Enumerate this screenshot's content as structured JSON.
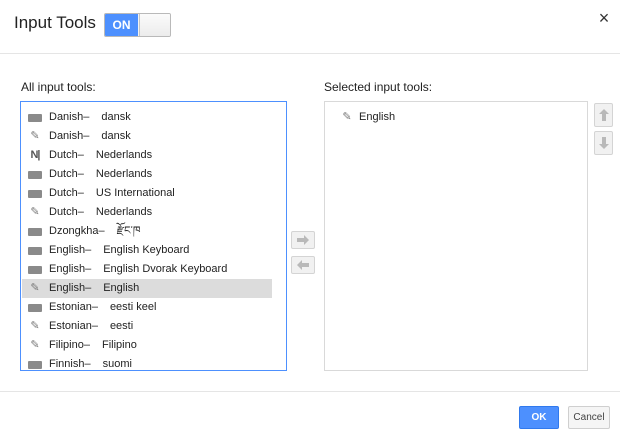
{
  "header": {
    "title": "Input Tools",
    "toggle_label": "ON",
    "close_glyph": "×"
  },
  "all_tools": {
    "label": "All input tools:",
    "items": [
      {
        "icon": "keyboard-icon",
        "lang": "Danish",
        "name": "dansk",
        "selected": false
      },
      {
        "icon": "pencil-icon",
        "lang": "Danish",
        "name": "dansk",
        "selected": false
      },
      {
        "icon": "nl-icon",
        "lang": "Dutch",
        "name": "Nederlands",
        "selected": false
      },
      {
        "icon": "keyboard-icon",
        "lang": "Dutch",
        "name": "Nederlands",
        "selected": false
      },
      {
        "icon": "keyboard-icon",
        "lang": "Dutch",
        "name": "US International",
        "selected": false
      },
      {
        "icon": "pencil-icon",
        "lang": "Dutch",
        "name": "Nederlands",
        "selected": false
      },
      {
        "icon": "keyboard-icon",
        "lang": "Dzongkha",
        "name": "རྫོང་ཁ",
        "selected": false
      },
      {
        "icon": "keyboard-icon",
        "lang": "English",
        "name": "English Keyboard",
        "selected": false
      },
      {
        "icon": "keyboard-icon",
        "lang": "English",
        "name": "English Dvorak Keyboard",
        "selected": false
      },
      {
        "icon": "pencil-icon",
        "lang": "English",
        "name": "English",
        "selected": true
      },
      {
        "icon": "keyboard-icon",
        "lang": "Estonian",
        "name": "eesti keel",
        "selected": false
      },
      {
        "icon": "pencil-icon",
        "lang": "Estonian",
        "name": "eesti",
        "selected": false
      },
      {
        "icon": "pencil-icon",
        "lang": "Filipino",
        "name": "Filipino",
        "selected": false
      },
      {
        "icon": "keyboard-icon",
        "lang": "Finnish",
        "name": "suomi",
        "selected": false
      }
    ],
    "separator": " –"
  },
  "selected_tools": {
    "label": "Selected input tools:",
    "items": [
      {
        "icon": "pencil-icon",
        "name": "English"
      }
    ]
  },
  "icons": {
    "add": "arrow-right-icon",
    "remove": "arrow-left-icon",
    "move_up": "arrow-up-icon",
    "move_down": "arrow-down-icon",
    "keyboard_glyph": "",
    "pencil_glyph": "✎",
    "nl_glyph": "N|"
  },
  "footer": {
    "ok_label": "OK",
    "cancel_label": "Cancel"
  },
  "colors": {
    "accent": "#4d90fe",
    "selected_row": "#dcdcdc"
  }
}
